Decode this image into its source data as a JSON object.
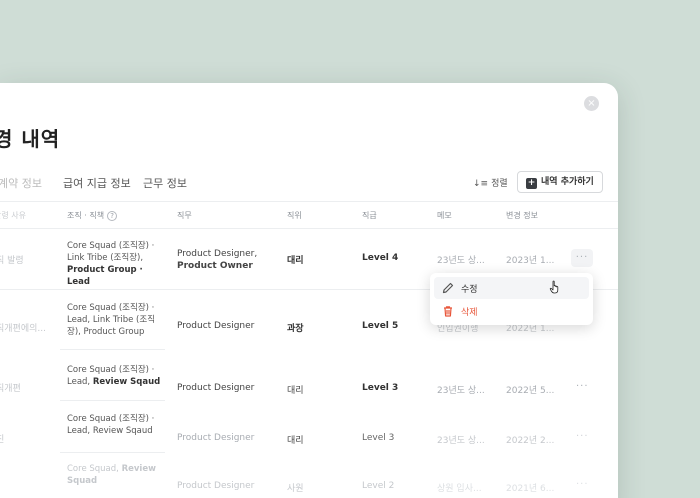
{
  "modal": {
    "title": "경 내역",
    "close_icon": "×",
    "tabs": [
      "계약 정보",
      "급여 지급 정보",
      "근무 정보"
    ],
    "sort_label": "정렬",
    "sort_icon": "↓≡",
    "add_label": "내역 추가하기",
    "add_icon": "+"
  },
  "table": {
    "headers": {
      "reason": "발령 사유",
      "org": "조직 · 직책",
      "job": "직무",
      "position": "직위",
      "grade": "직급",
      "memo": "메모",
      "change": "변경 정보"
    },
    "rows": [
      {
        "reason": "직 발령",
        "org_a": "Core Squad (조직장) · Link Tribe (조직장), ",
        "org_b": "Product Group · Lead",
        "job": "Product Designer, ",
        "job_b": "Product Owner",
        "position": "대리",
        "grade": "Level 4",
        "memo": "23년도 상...",
        "change": "2023년 1..."
      },
      {
        "reason": "직개편에의...",
        "org_a": "Core Squad (조직장) · Lead, Link Tribe (조직장), Product Group",
        "job": "Product Designer",
        "position": "과장",
        "grade": "Level 5",
        "memo": "인입권이행",
        "change": "2022년 1..."
      },
      {
        "reason": "직개편",
        "org_a": "Core Squad (조직장) · Lead, ",
        "org_b": "Review Sqaud",
        "job": "Product Designer",
        "position": "대리",
        "grade": "Level 3",
        "memo": "23년도 상...",
        "change": "2022년 5..."
      },
      {
        "reason": "진",
        "org_a": "Core Squad (조직장) · Lead, Review Sqaud",
        "job": "Product Designer",
        "position": "대리",
        "grade": "Level 3",
        "memo": "23년도 상...",
        "change": "2022년 2..."
      },
      {
        "reason": "",
        "org_a": "Core Squad, ",
        "org_b": "Review Squad",
        "job": "Product Designer",
        "position": "사원",
        "grade": "Level 2",
        "memo": "상원 입사...",
        "change": "2021년 6..."
      }
    ],
    "more_icon": "···"
  },
  "menu": {
    "edit_label": "수정",
    "delete_label": "삭제"
  },
  "colors": {
    "background": "#cfddd6",
    "danger": "#e8563a",
    "text": "#333333"
  }
}
